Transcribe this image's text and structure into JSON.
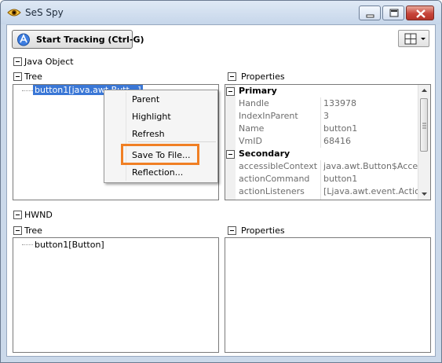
{
  "window": {
    "title": "SeS Spy"
  },
  "toolbar": {
    "start_tracking": "Start Tracking (Ctrl-G)"
  },
  "java": {
    "group_label": "Java Object",
    "tree_label": "Tree",
    "tree_node": "button1[java.awt.Butt...]",
    "properties_label": "Properties",
    "categories": {
      "primary": "Primary",
      "secondary": "Secondary"
    },
    "primary": [
      {
        "name": "Handle",
        "value": "133978"
      },
      {
        "name": "IndexInParent",
        "value": "3"
      },
      {
        "name": "Name",
        "value": "button1"
      },
      {
        "name": "VmID",
        "value": "68416"
      }
    ],
    "secondary": [
      {
        "name": "accessibleContext",
        "value": "java.awt.Button$Accessil"
      },
      {
        "name": "actionCommand",
        "value": "button1"
      },
      {
        "name": "actionListeners",
        "value": "[Ljava.awt.event.ActionL"
      }
    ]
  },
  "context_menu": {
    "parent": "Parent",
    "highlight": "Highlight",
    "refresh": "Refresh",
    "save_to_file": "Save To File...",
    "reflection": "Reflection..."
  },
  "hwnd": {
    "group_label": "HWND",
    "tree_label": "Tree",
    "tree_node": "button1[Button]",
    "properties_label": "Properties"
  },
  "colors": {
    "highlight_box": "#f07f24",
    "selection": "#3a77d6"
  }
}
